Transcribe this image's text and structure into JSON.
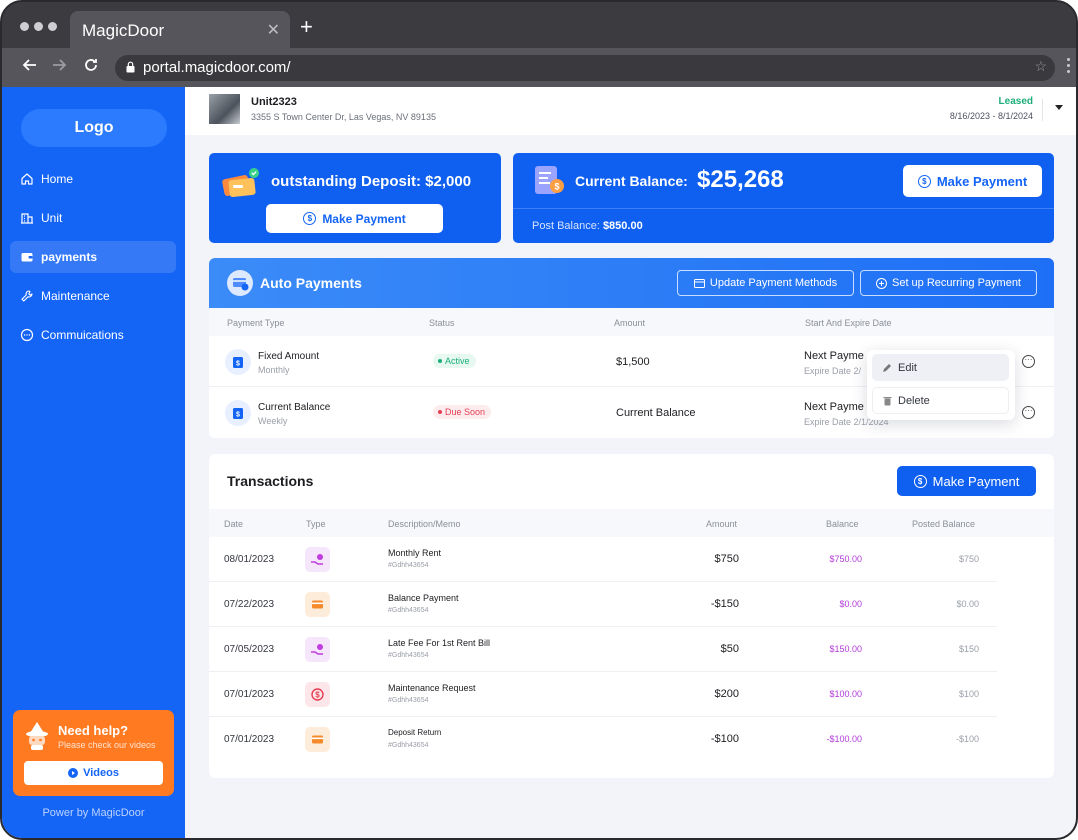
{
  "browser": {
    "tab_title": "MagicDoor",
    "tab_close": "✕",
    "new_tab": "+",
    "url": "portal.magicdoor.com/"
  },
  "sidebar": {
    "logo": "Logo",
    "items": [
      {
        "label": "Home",
        "icon": "home-icon"
      },
      {
        "label": "Unit",
        "icon": "building-icon"
      },
      {
        "label": "payments",
        "icon": "wallet-icon",
        "active": true
      },
      {
        "label": "Maintenance",
        "icon": "wrench-icon"
      },
      {
        "label": "Commuications",
        "icon": "chat-icon"
      }
    ],
    "help": {
      "title": "Need help?",
      "subtitle": "Please check our videos",
      "button": "Videos"
    },
    "powered_by": "Power by MagicDoor"
  },
  "header": {
    "unit_name": "Unit2323",
    "unit_address": "3355 S Town Center Dr, Las Vegas, NV 89135",
    "status": "Leased",
    "dates": "8/16/2023 - 8/1/2024"
  },
  "deposit_card": {
    "label": "outstanding  Deposit:",
    "value": "$2,000",
    "button": "Make Payment"
  },
  "balance_card": {
    "label": "Current Balance:",
    "value": "$25,268",
    "button": "Make Payment",
    "post_label": "Post Balance:",
    "post_value": "$850.00"
  },
  "auto_payments": {
    "title": "Auto Payments",
    "update_button": "Update Payment Methods",
    "recurring_button": "Set up Recurring Payment",
    "columns": [
      "Payment Type",
      "Status",
      "Amount",
      "Start And Expire Date"
    ],
    "rows": [
      {
        "name": "Fixed Amount",
        "frequency": "Monthly",
        "status": "Active",
        "amount": "$1,500",
        "next": "Next Payme",
        "expire": "Expire Date 2/"
      },
      {
        "name": "Current Balance",
        "frequency": "Weekly",
        "status": "Due Soon",
        "amount": "Current Balance",
        "next": "Next Payme",
        "expire": "Expire Date 2/1/2024"
      }
    ],
    "menu": {
      "edit": "Edit",
      "delete": "Delete"
    }
  },
  "transactions": {
    "title": "Transactions",
    "button": "Make Payment",
    "columns": [
      "Date",
      "Type",
      "Description/Memo",
      "Amount",
      "Balance",
      "Posted Balance"
    ],
    "rows": [
      {
        "date": "08/01/2023",
        "type_icon": "hand-money-icon",
        "desc": "Monthly Rent",
        "memo": "#Gdhh43654",
        "amount": "$750",
        "balance": "$750.00",
        "posted": "$750"
      },
      {
        "date": "07/22/2023",
        "type_icon": "card-icon",
        "desc": "Balance Payment",
        "memo": "#Gdhh43654",
        "amount": "-$150",
        "balance": "$0.00",
        "posted": "$0.00"
      },
      {
        "date": "07/05/2023",
        "type_icon": "hand-money-icon",
        "desc": "Late Fee For 1st Rent Bill",
        "memo": "#Gdhh43654",
        "amount": "$50",
        "balance": "$150.00",
        "posted": "$150"
      },
      {
        "date": "07/01/2023",
        "type_icon": "dollar-refresh-icon",
        "desc": "Maintenance Request",
        "memo": "#Gdhh43654",
        "amount": "$200",
        "balance": "$100.00",
        "posted": "$100"
      },
      {
        "date": "07/01/2023",
        "type_icon": "card-icon",
        "desc": "Deposit Return",
        "memo": "#Gdhh43654",
        "amount": "-$100",
        "balance": "-$100.00",
        "posted": "-$100"
      }
    ]
  },
  "colors": {
    "primary": "#1464f6",
    "help_orange": "#ff7a21",
    "active_green": "#1cae7a",
    "due_red": "#e53e52",
    "balance_purple": "#b13bd9"
  }
}
